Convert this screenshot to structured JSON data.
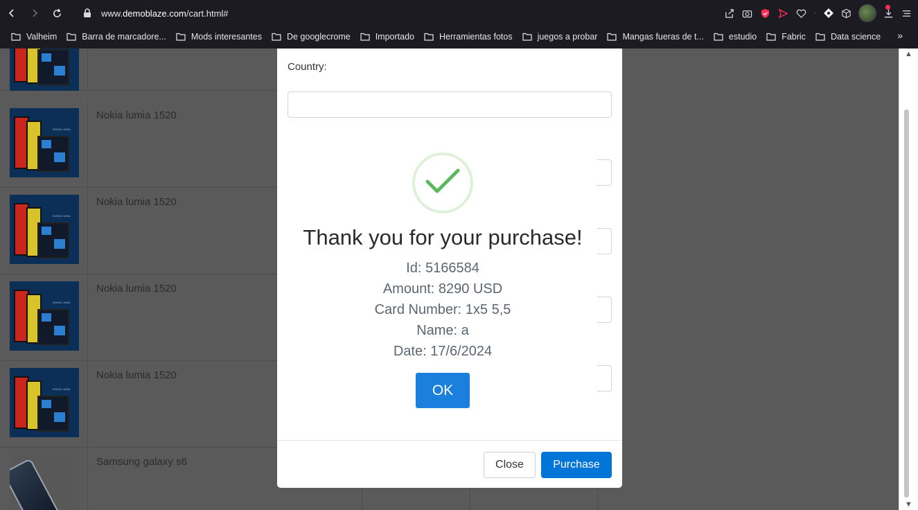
{
  "browser": {
    "url_prefix": "www.",
    "url_host": "demoblaze.com",
    "url_path": "/cart.html#"
  },
  "bookmarks": [
    {
      "label": "Valheim"
    },
    {
      "label": "Barra de marcadore..."
    },
    {
      "label": "Mods interesantes"
    },
    {
      "label": "De googlecrome"
    },
    {
      "label": "Importado"
    },
    {
      "label": "Herramientas fotos"
    },
    {
      "label": "juegos a probar"
    },
    {
      "label": "Mangas fueras de t..."
    },
    {
      "label": "estudio"
    },
    {
      "label": "Fabric"
    },
    {
      "label": "Data science"
    }
  ],
  "cart": {
    "rows": [
      {
        "name": "Nokia lumia 1520",
        "thumb_label": "NOKIA LUMIA"
      },
      {
        "name": "Nokia lumia 1520",
        "thumb_label": "NOKIA LUMIA"
      },
      {
        "name": "Nokia lumia 1520",
        "thumb_label": "NOKIA LUMIA"
      },
      {
        "name": "Nokia lumia 1520",
        "thumb_label": "NOKIA LUMIA"
      },
      {
        "name": "Samsung galaxy s6"
      }
    ]
  },
  "modal": {
    "country_label": "Country:",
    "country_value": "",
    "close_label": "Close",
    "purchase_label": "Purchase"
  },
  "alert": {
    "title": "Thank you for your purchase!",
    "id_line": "Id: 5166584",
    "amount_line": "Amount: 8290 USD",
    "card_line": "Card Number: 1x5 5,5",
    "name_line": "Name: a",
    "date_line": "Date: 17/6/2024",
    "ok_label": "OK"
  },
  "colors": {
    "accent": "#0275d8",
    "ok_button": "#1b7fde",
    "check": "#5cb85c",
    "overlay": "#5a5a5a"
  }
}
